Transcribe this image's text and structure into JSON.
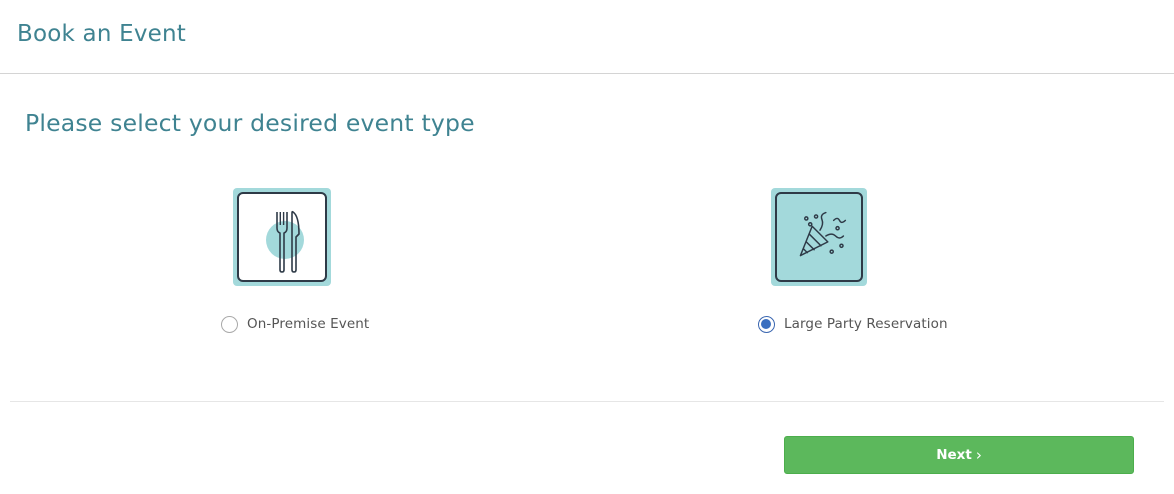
{
  "header": {
    "title": "Book an Event"
  },
  "main": {
    "prompt": "Please select your desired event type",
    "options": [
      {
        "label": "On-Premise Event",
        "icon": "fork-knife-icon",
        "selected": false
      },
      {
        "label": "Large Party Reservation",
        "icon": "party-popper-icon",
        "selected": true
      }
    ]
  },
  "footer": {
    "next_label": "Next",
    "next_chevron": "›"
  },
  "colors": {
    "title": "#3f8391",
    "card_accent": "#a3d9db",
    "card_border": "#2e3a47",
    "radio_checked": "#3a6fc0",
    "next_button": "#5cb85c"
  }
}
